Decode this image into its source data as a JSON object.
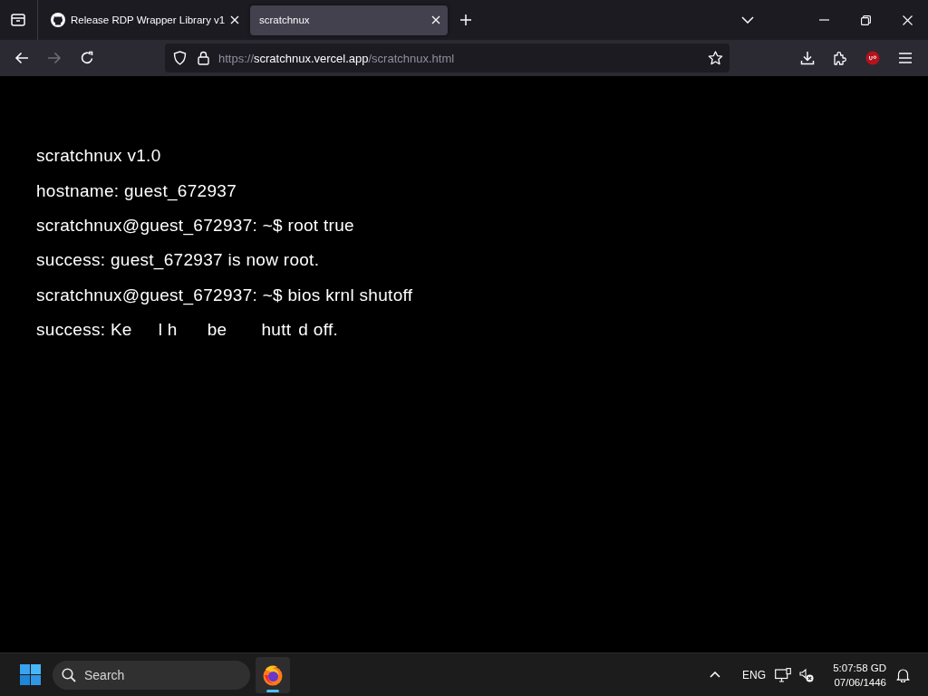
{
  "browser": {
    "tabs": [
      {
        "title": "Release RDP Wrapper Library v1",
        "has_icon": true,
        "selected": false
      },
      {
        "title": "scratchnux",
        "has_icon": false,
        "selected": true
      }
    ],
    "nav_buttons": [
      {
        "kind": "back",
        "disabled": false
      },
      {
        "kind": "forward",
        "disabled": true
      },
      {
        "kind": "reload",
        "disabled": false
      }
    ],
    "address_bar": {
      "scheme": "https://",
      "host": "scratchnux.vercel.app",
      "path": "/scratchnux.html"
    }
  },
  "terminal": {
    "lines": [
      {
        "segments": [
          "scratchnux v1.0"
        ]
      },
      {
        "segments": [
          "hostname: guest_672937"
        ]
      },
      {
        "segments": [
          "scratchnux@guest_672937: ~$ root true"
        ]
      },
      {
        "segments": [
          "success: guest_672937 is now root."
        ]
      },
      {
        "segments": [
          "scratchnux@guest_672937: ~$ bios krnl shutoff"
        ]
      },
      {
        "segments": [
          "success: Ke",
          "l h",
          "be",
          "hutt",
          "d off."
        ]
      }
    ]
  },
  "taskbar": {
    "search": {
      "placeholder": "Search"
    },
    "apps": [
      {
        "kind": "browser",
        "active": true
      }
    ],
    "language": "ENG",
    "time": "5:07:58 GD",
    "date": "07/06/1446"
  }
}
